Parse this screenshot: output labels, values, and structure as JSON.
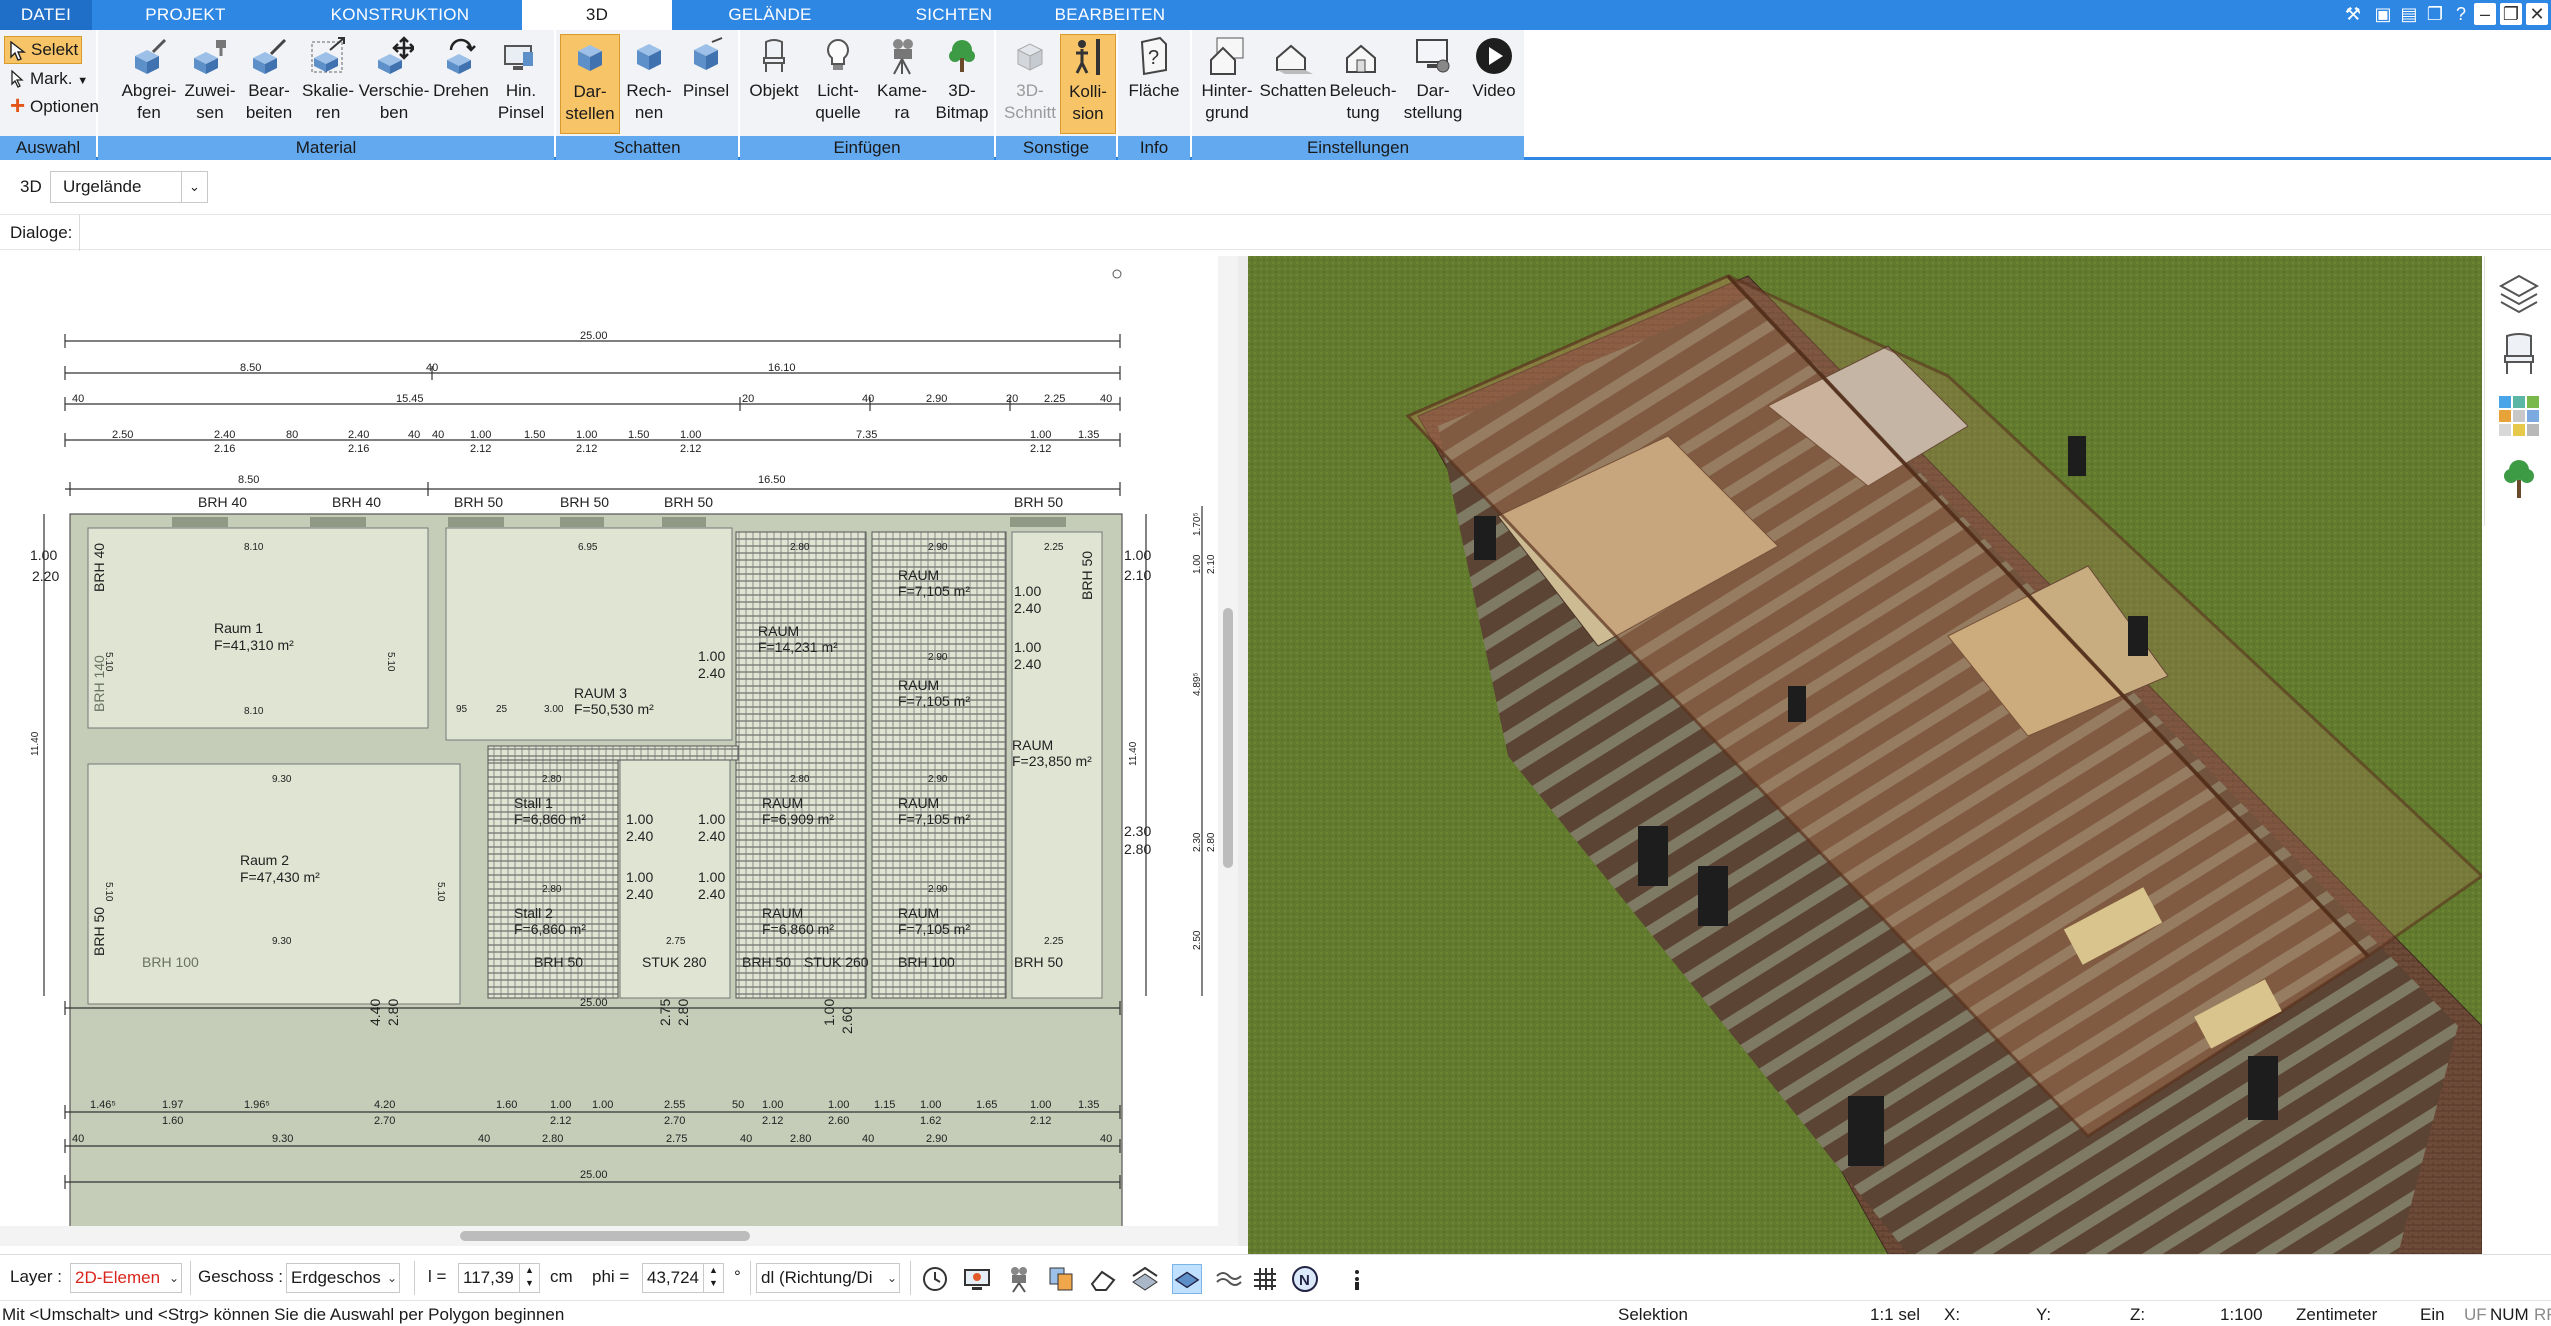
{
  "tabs": [
    {
      "key": "datei",
      "label": "DATEI"
    },
    {
      "key": "projekt",
      "label": "PROJEKT"
    },
    {
      "key": "konstruktion",
      "label": "KONSTRUKTION"
    },
    {
      "key": "3d",
      "label": "3D",
      "active": true
    },
    {
      "key": "gelaende",
      "label": "GELÄNDE"
    },
    {
      "key": "sichten",
      "label": "SICHTEN"
    },
    {
      "key": "bearbeiten",
      "label": "BEARBEITEN"
    }
  ],
  "ribbon": {
    "auswahl": {
      "select": "Selekt",
      "mark": "Mark.",
      "options": "Optionen",
      "group": "Auswahl"
    },
    "material": {
      "group": "Material",
      "buttons": [
        "Abgrei-\nfen",
        "Zuwei-\nsen",
        "Bear-\nbeiten",
        "Skalie-\nren",
        "Verschie-\nben",
        "Drehen",
        "Hin.\nPinsel"
      ]
    },
    "schatten": {
      "group": "Schatten",
      "buttons": [
        "Dar-\nstellen",
        "Rech-\nnen",
        "Pinsel"
      ]
    },
    "einfuegen": {
      "group": "Einfügen",
      "buttons": [
        "Objekt",
        "Licht-\nquelle",
        "Kame-\nra",
        "3D-\nBitmap"
      ]
    },
    "sonstige": {
      "group": "Sonstige",
      "buttons": [
        "3D-\nSchnitt",
        "Kolli-\nsion"
      ]
    },
    "info": {
      "group": "Info",
      "buttons": [
        "Fläche"
      ]
    },
    "einstellungen": {
      "group": "Einstellungen",
      "buttons": [
        "Hinter-\ngrund",
        "Schatten",
        "Beleuch-\ntung",
        "Dar-\nstellung",
        "Video"
      ]
    }
  },
  "viewbar": {
    "label": "3D",
    "selected": "Urgelände"
  },
  "dialogbar": {
    "label": "Dialoge:"
  },
  "plan": {
    "rooms": [
      {
        "name": "Raum 1",
        "area": "F=41,310 m²"
      },
      {
        "name": "Raum 2",
        "area": "F=47,430 m²"
      },
      {
        "name": "RAUM 3",
        "area": "F=50,530 m²"
      },
      {
        "name": "Stall 1",
        "area": "F=6,860 m²"
      },
      {
        "name": "Stall 2",
        "area": "F=6,860 m²"
      },
      {
        "name": "RAUM",
        "area": "F=14,231 m²"
      },
      {
        "name": "RAUM",
        "area": "F=7,105 m²"
      },
      {
        "name": "RAUM",
        "area": "F=7,105 m²"
      },
      {
        "name": "RAUM",
        "area": "F=6,909 m²"
      },
      {
        "name": "RAUM",
        "area": "F=7,105 m²"
      },
      {
        "name": "RAUM",
        "area": "F=6,860 m²"
      },
      {
        "name": "RAUM",
        "area": "F=7,105 m²"
      },
      {
        "name": "RAUM",
        "area": "F=23,850 m²"
      }
    ],
    "brh_top": [
      "BRH 40",
      "BRH 40",
      "BRH 50",
      "BRH 50",
      "BRH 50",
      "BRH 50"
    ],
    "brh_bottom": [
      "BRH 100",
      "BRH 50",
      "STUK 280",
      "BRH 50",
      "STUK 260",
      "BRH 100",
      "BRH 50"
    ],
    "brh_side": [
      "BRH 40",
      "BRH 140",
      "BRH 50",
      "BRH 50"
    ],
    "dims_top": {
      "row1": [
        "25.00"
      ],
      "row2": [
        "8.50",
        "40",
        "16.10"
      ],
      "row3": [
        "40",
        "15.45",
        "20",
        "40",
        "2.90",
        "20",
        "2.25",
        "40"
      ],
      "row4a": [
        "2.50",
        "2.40",
        "80",
        "2.40",
        "40",
        "40",
        "1.00",
        "1.50",
        "1.00",
        "1.50",
        "1.00",
        "7.35",
        "1.00",
        "1.35"
      ],
      "row4b": [
        "2.16",
        "2.16",
        "2.12",
        "2.12",
        "2.12",
        "2.12"
      ],
      "row5": [
        "8.50",
        "16.50"
      ]
    },
    "dims_bottom": {
      "row1": [
        "25.00"
      ],
      "row2a": [
        "1.46⁵",
        "1.97",
        "1.96⁵",
        "4.20",
        "1.60",
        "1.00",
        "1.00",
        "2.55",
        "50",
        "1.00",
        "1.00",
        "1.15",
        "1.00",
        "1.65",
        "1.00",
        "1.35"
      ],
      "row2b": [
        "1.60",
        "2.70",
        "2.12",
        "2.70",
        "2.12",
        "2.60",
        "1.62",
        "2.12"
      ],
      "row3": [
        "40",
        "9.30",
        "40",
        "2.80",
        "2.75",
        "40",
        "2.80",
        "40",
        "2.90",
        "40"
      ],
      "row4": [
        "25.00"
      ],
      "openings": [
        "4.40",
        "2.80",
        "2.75",
        "2.80",
        "1.00",
        "2.60"
      ]
    },
    "dims_inner": [
      "8.10",
      "6.95",
      "2.80",
      "2.90",
      "2.25",
      "8.10",
      "9.30",
      "9.30",
      "5.10",
      "5.10",
      "5.10",
      "5.10",
      "95",
      "25",
      "3.00",
      "2.80",
      "2.80",
      "2.80",
      "2.75",
      "2.90",
      "2.90",
      "2.90",
      "2.25",
      "1.00",
      "2.40",
      "1.00",
      "2.40",
      "1.00",
      "2.40",
      "1.00",
      "2.40",
      "1.00",
      "2.40",
      "1.00",
      "2.40",
      "1.00",
      "2.40"
    ],
    "dims_left": [
      "1.00",
      "2.20",
      "11.40"
    ],
    "dims_right": [
      "1.00",
      "2.10",
      "11.40",
      "2.30",
      "2.80",
      "1.00",
      "2.10",
      "4.89⁵",
      "2.30",
      "2.80",
      "2.50",
      "1.70⁵"
    ]
  },
  "bottombar": {
    "layer_label": "Layer :",
    "layer_value": "2D-Elemen",
    "geschoss_label": "Geschoss :",
    "geschoss_value": "Erdgeschos",
    "l_label": "l =",
    "l_value": "117,39",
    "l_unit": "cm",
    "phi_label": "phi =",
    "phi_value": "43,724",
    "phi_unit": "°",
    "dl_value": "dl (Richtung/Di"
  },
  "statusbar": {
    "hint": "Mit <Umschalt> und <Strg> können Sie die Auswahl per Polygon beginnen",
    "mode": "Selektion",
    "sel": "1:1 sel",
    "x": "X:",
    "y": "Y:",
    "z": "Z:",
    "scale": "1:100",
    "unit": "Zentimeter",
    "ein": "Ein",
    "uf": "UF",
    "num": "NUM",
    "rf": "RF"
  },
  "colors": {
    "tabbar": "#2f87e4",
    "group_label": "#62a9ef",
    "selected": "#f7c468",
    "layer_value": "#d9261c",
    "grass": "#5f7a2c"
  }
}
